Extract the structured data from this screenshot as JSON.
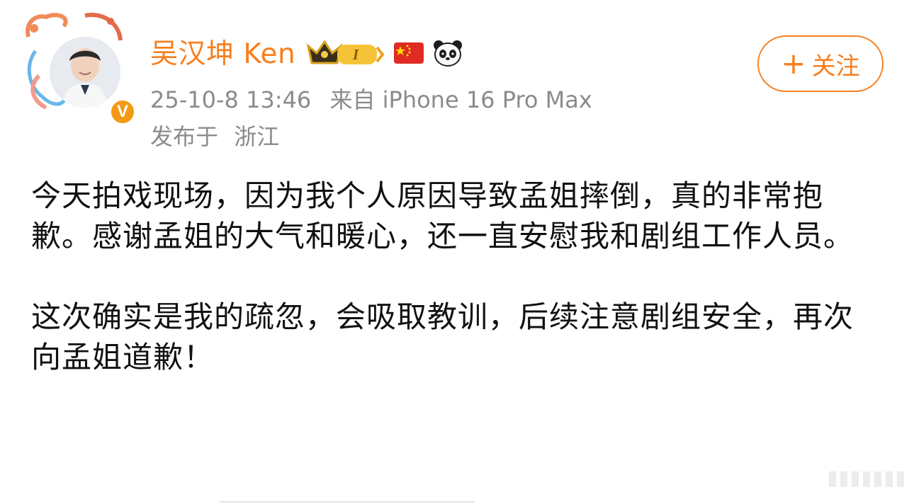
{
  "colors": {
    "accent": "#f77f1f",
    "muted": "#8b8b8b",
    "text": "#111111",
    "badge": "#f39a14"
  },
  "user": {
    "name": "吴汉坤 Ken",
    "verified_mark": "V",
    "badges": [
      "crown-level-badge",
      "china-flag-badge",
      "panda-badge"
    ],
    "level_label": "I"
  },
  "meta": {
    "timestamp": "25-10-8 13:46",
    "source": "来自 iPhone 16 Pro Max",
    "location_prefix": "发布于",
    "location": "浙江"
  },
  "follow_button": {
    "label": "关注",
    "icon": "plus-icon"
  },
  "post": {
    "paragraphs": [
      "今天拍戏现场，因为我个人原因导致孟姐摔倒，真的非常抱歉。感谢孟姐的大气和暖心，还一直安慰我和剧组工作人员。",
      "这次确实是我的疏忽，会吸取教训，后续注意剧组安全，再次向孟姐道歉！"
    ]
  }
}
